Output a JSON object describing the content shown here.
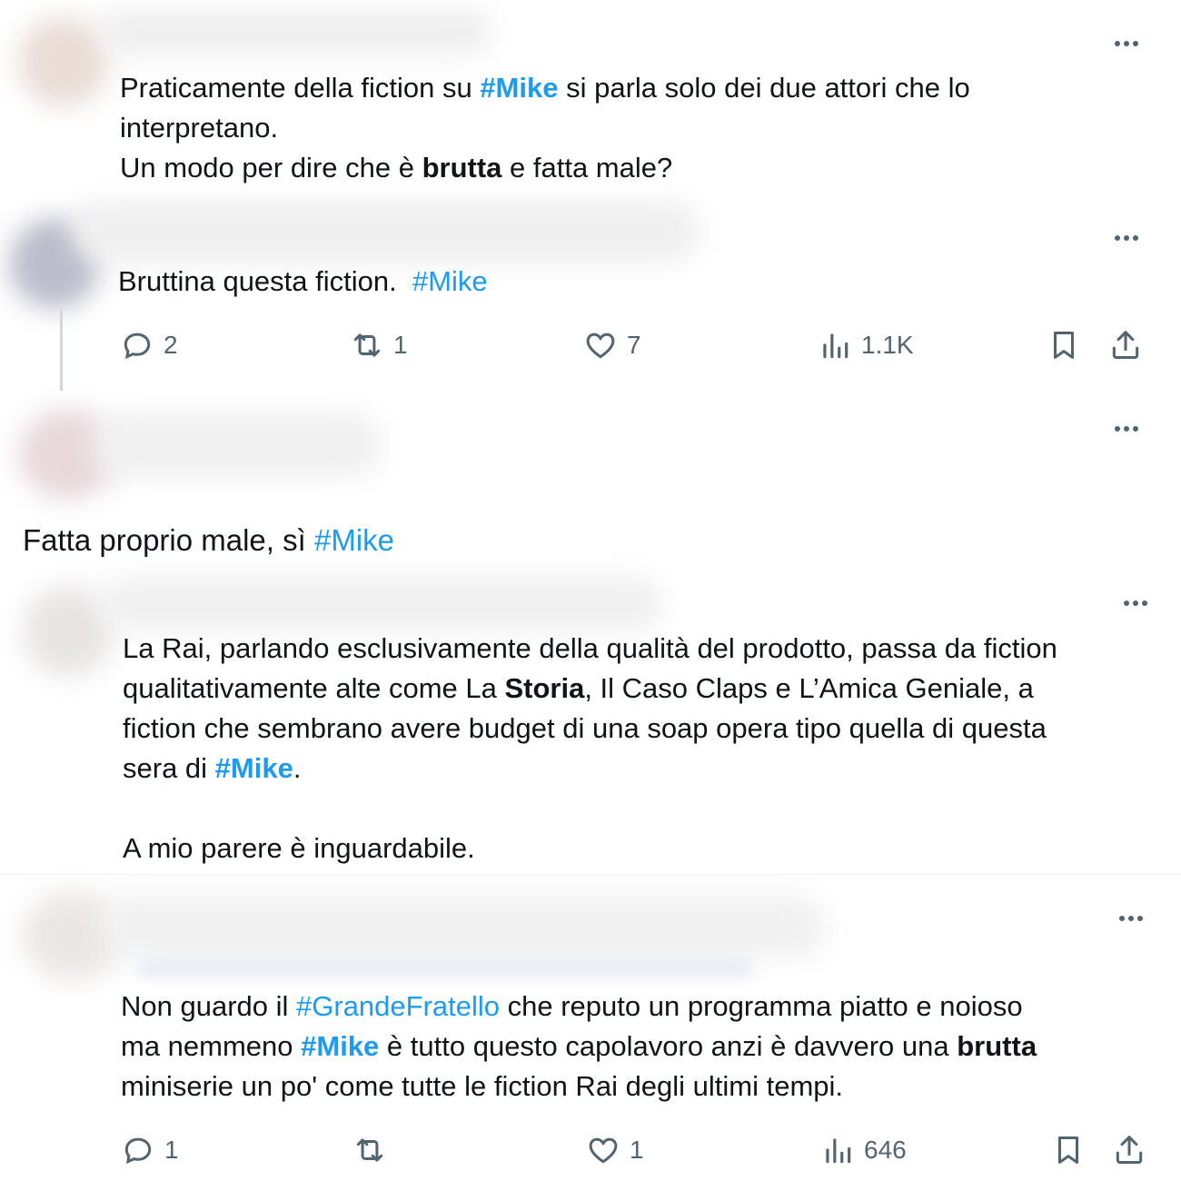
{
  "tweets": [
    {
      "text_parts": [
        [
          "Praticamente della fiction su ",
          "",
          "#Mike",
          "",
          " si parla solo dei due attori che lo"
        ],
        [
          "interpretano."
        ],
        [
          "Un modo per dire che è ",
          "brutta",
          " e fatta male?"
        ]
      ]
    },
    {
      "text": "Bruttina questa fiction.",
      "hashtag": "#Mike",
      "replies": "2",
      "reposts": "1",
      "likes": "7",
      "views": "1.1K"
    },
    {
      "text": "Fatta proprio male, sì ",
      "hashtag": "#Mike"
    },
    {
      "line1": "La Rai, parlando esclusivamente della qualità del prodotto, passa da fiction",
      "line2_a": "qualitativamente alte come La ",
      "line2_b": "Storia",
      "line2_c": ", Il Caso Claps e L’Amica Geniale, a",
      "line3": "fiction che sembrano avere budget di una soap opera tipo quella di questa",
      "line4_a": "sera di ",
      "line4_tag": "#Mike",
      "line4_c": ".",
      "line5": "A mio parere è inguardabile."
    },
    {
      "line1_a": "Non guardo il ",
      "line1_tag": "#GrandeFratello",
      "line1_c": " che reputo un programma piatto e  noioso",
      "line2_a": "ma nemmeno ",
      "line2_tag": "#Mike",
      "line2_c": " è tutto questo capolavoro anzi è davvero una ",
      "line2_bold": "brutta",
      "line3": "miniserie un po' come tutte le fiction Rai degli ultimi tempi.",
      "replies": "1",
      "reposts": "",
      "likes": "1",
      "views": "646"
    }
  ],
  "t1": {
    "a": "Praticamente della fiction su ",
    "tag": "#Mike",
    "c": " si parla solo dei due attori che lo",
    "line2": "interpretano.",
    "line3_a": "Un modo per dire che è ",
    "line3_bold": "brutta",
    "line3_c": " e fatta male?"
  },
  "colors": {
    "link": "#1d9bf0",
    "muted": "#536471",
    "text": "#0f1419"
  },
  "icons": [
    "more-icon",
    "reply-icon",
    "repost-icon",
    "like-icon",
    "views-icon",
    "bookmark-icon",
    "share-icon"
  ]
}
